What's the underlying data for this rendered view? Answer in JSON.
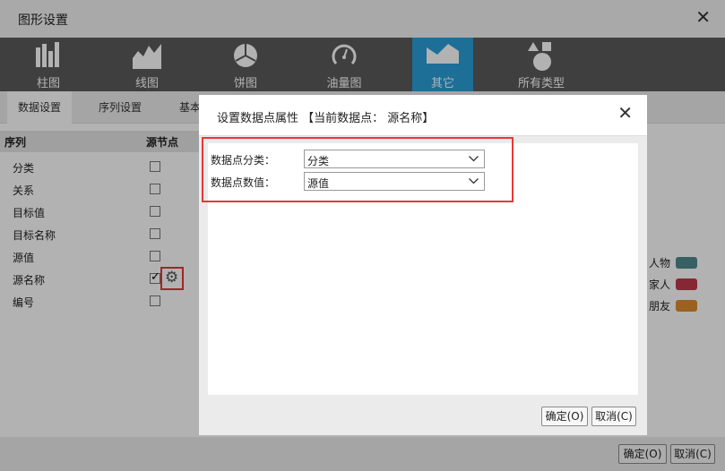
{
  "window": {
    "title": "图形设置",
    "close_glyph": "✕"
  },
  "chart_types": [
    {
      "label": "柱图",
      "icon": "bar-chart-icon"
    },
    {
      "label": "线图",
      "icon": "area-chart-icon"
    },
    {
      "label": "饼图",
      "icon": "pie-chart-icon"
    },
    {
      "label": "油量图",
      "icon": "gauge-icon"
    },
    {
      "label": "其它",
      "icon": "other-chart-icon",
      "active": true
    },
    {
      "label": "所有类型",
      "icon": "shapes-icon"
    }
  ],
  "tabs": [
    {
      "label": "数据设置",
      "active": true
    },
    {
      "label": "序列设置"
    },
    {
      "label": "基本"
    }
  ],
  "grid": {
    "headers": [
      "序列",
      "源节点"
    ],
    "rows": [
      {
        "name": "分类",
        "checked": false
      },
      {
        "name": "关系",
        "checked": false
      },
      {
        "name": "目标值",
        "checked": false
      },
      {
        "name": "目标名称",
        "checked": false
      },
      {
        "name": "源值",
        "checked": false
      },
      {
        "name": "源名称",
        "checked": true
      },
      {
        "name": "编号",
        "checked": false
      }
    ]
  },
  "legend": [
    {
      "label": "人物",
      "color": "#4f8a8e"
    },
    {
      "label": "家人",
      "color": "#c0394b"
    },
    {
      "label": "朋友",
      "color": "#de8c2f"
    }
  ],
  "dialog": {
    "title": "设置数据点属性 【当前数据点： 源名称】",
    "close_glyph": "✕",
    "fields": [
      {
        "label": "数据点分类：",
        "value": "分类"
      },
      {
        "label": "数据点数值：",
        "value": "源值"
      }
    ],
    "ok": "确定(O)",
    "cancel": "取消(C)"
  },
  "footer": {
    "ok": "确定(O)",
    "cancel": "取消(C)"
  },
  "colors": {
    "accent": "#2a9fd8",
    "highlight": "#e53935",
    "toolbar": "#5b5b5b"
  }
}
